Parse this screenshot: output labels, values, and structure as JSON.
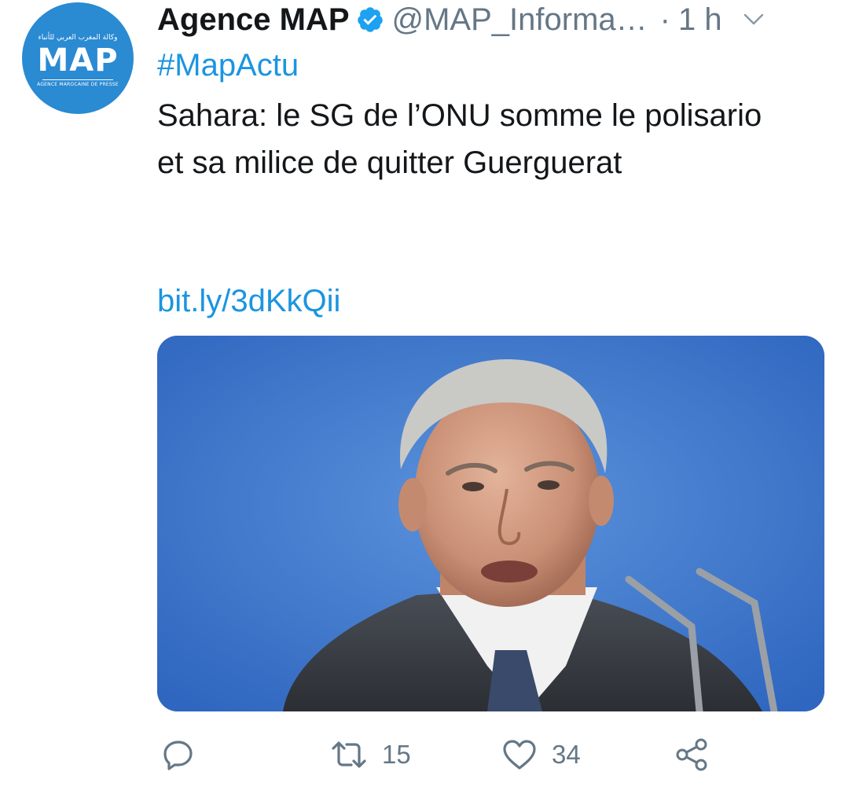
{
  "tweet": {
    "avatar": {
      "arabic_text": "وكالة المغرب العربي للأنباء",
      "logo_text": "MAP",
      "subtitle": "AGENCE MAROCAINE DE PRESSE"
    },
    "author_name": "Agence MAP",
    "verified_icon": "verified-badge-icon",
    "handle": "@MAP_Informa…",
    "separator": "·",
    "time": "1 h",
    "menu_icon": "chevron-down-icon",
    "hashtag": "#MapActu",
    "text": "Sahara: le SG de l’ONU somme le polisario et sa milice de quitter Guerguerat",
    "link": "bit.ly/3dKkQii",
    "media": {
      "icon": "photo-image",
      "background_color": "#3f7bd0"
    },
    "actions": {
      "reply": {
        "icon": "reply-bubble-icon",
        "count": ""
      },
      "retweet": {
        "icon": "retweet-icon",
        "count": "15"
      },
      "like": {
        "icon": "heart-icon",
        "count": "34"
      },
      "share": {
        "icon": "share-icon"
      }
    },
    "colors": {
      "link": "#1b95e0",
      "secondary_text": "#657786",
      "primary_text": "#14171a",
      "avatar_bg": "#2a8ad2"
    }
  }
}
